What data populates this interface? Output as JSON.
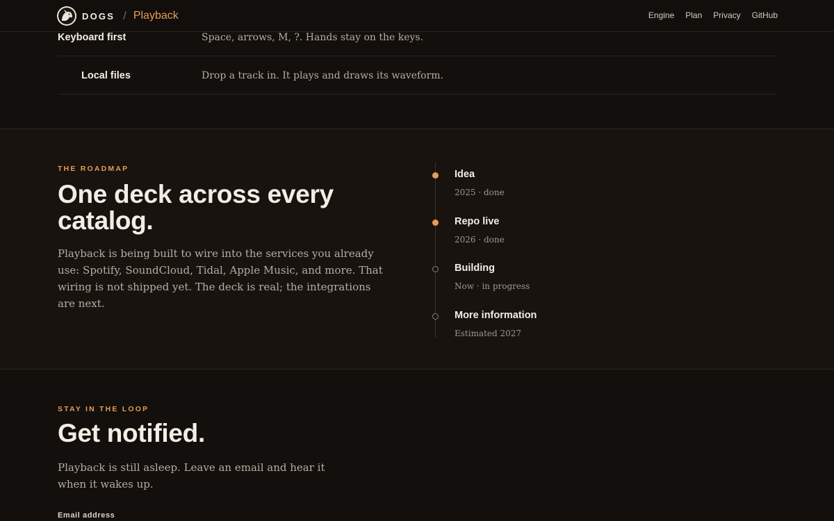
{
  "nav": {
    "brand": "DOGS",
    "separator": "/",
    "product": "Playback",
    "links": [
      "Engine",
      "Plan",
      "Privacy",
      "GitHub"
    ]
  },
  "features": [
    {
      "title": "Keyboard first",
      "description": "Space, arrows, M, ?. Hands stay on the keys."
    },
    {
      "title": "Local files",
      "description": "Drop a track in. It plays and draws its waveform."
    }
  ],
  "roadmap": {
    "eyebrow": "THE ROADMAP",
    "heading": "One deck across every catalog.",
    "body": "Playback is being built to wire into the services you already use: Spotify, SoundCloud, Tidal, Apple Music, and more. That wiring is not shipped yet. The deck is real; the integrations are next.",
    "milestones": [
      {
        "title": "Idea",
        "meta": "2025 · done",
        "status": "done"
      },
      {
        "title": "Repo live",
        "meta": "2026 · done",
        "status": "done"
      },
      {
        "title": "Building",
        "meta": "Now · in progress",
        "status": "open"
      },
      {
        "title": "More information",
        "meta": "Estimated 2027",
        "status": "open"
      }
    ]
  },
  "notify": {
    "eyebrow": "STAY IN THE LOOP",
    "heading": "Get notified.",
    "body": "Playback is still asleep. Leave an email and hear it when it wakes up.",
    "email_label": "Email address"
  },
  "colors": {
    "accent": "#e89a5b",
    "background": "#120f0c",
    "section_background": "#18130e"
  },
  "icons": {
    "logo": "dog-head-logo-icon"
  }
}
